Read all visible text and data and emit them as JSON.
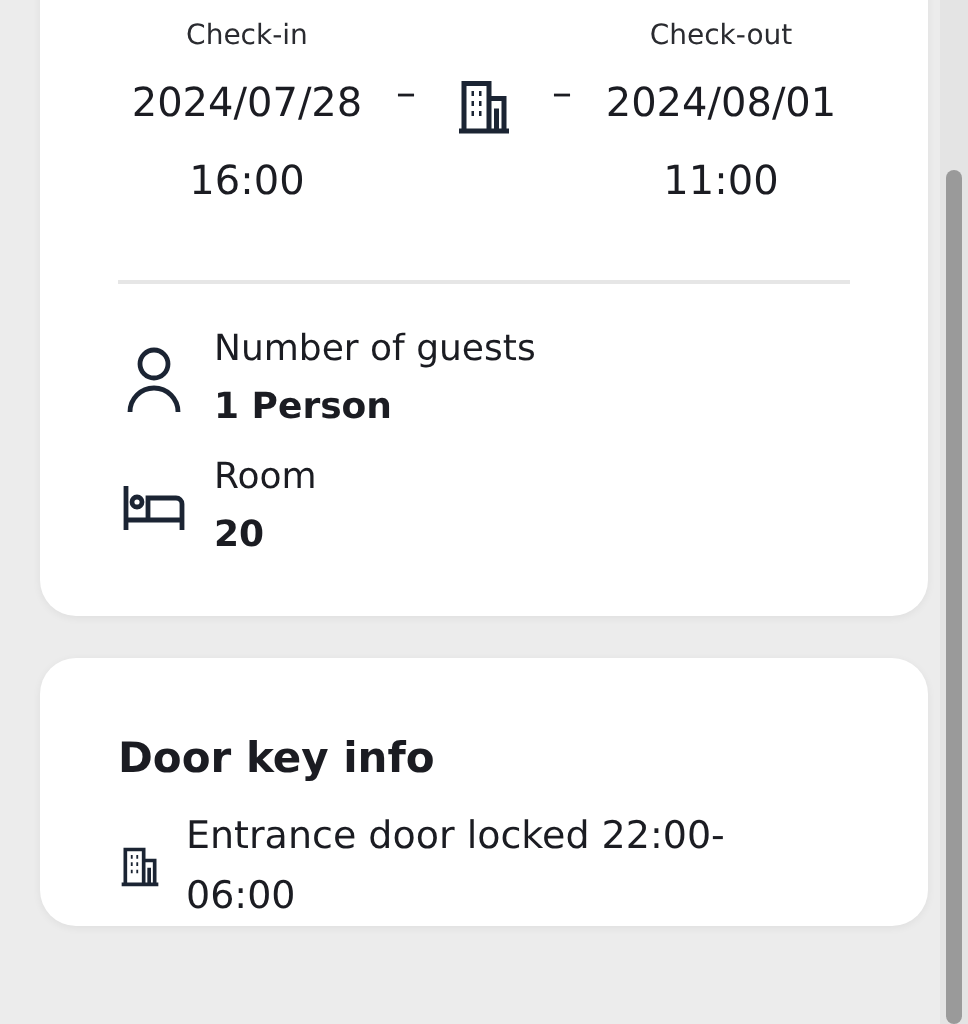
{
  "stay": {
    "check_in": {
      "label": "Check-in",
      "date": "2024/07/28",
      "time": "16:00"
    },
    "separator": "–",
    "check_out": {
      "label": "Check-out",
      "date": "2024/08/01",
      "time": "11:00"
    },
    "details": [
      {
        "kind": "guests",
        "label": "Number of guests",
        "value": "1 Person"
      },
      {
        "kind": "room",
        "label": "Room",
        "value": "20"
      }
    ]
  },
  "door_key_info": {
    "title": "Door key info",
    "items": [
      {
        "text": "Entrance door locked 22:00-06:00"
      }
    ]
  }
}
